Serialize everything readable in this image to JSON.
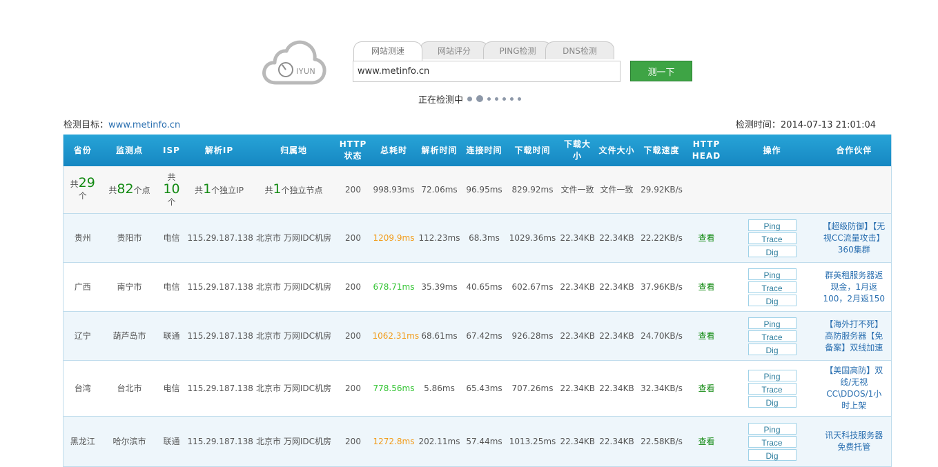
{
  "logo": {
    "text": "IYUN",
    "icon": "cloud-clock-logo"
  },
  "tabs": [
    {
      "label": "网站测速",
      "active": true
    },
    {
      "label": "网站评分",
      "active": false
    },
    {
      "label": "PING检测",
      "active": false
    },
    {
      "label": "DNS检测",
      "active": false
    }
  ],
  "search": {
    "value": "www.metinfo.cn"
  },
  "test_button": "测一下",
  "progress": {
    "label": "正在检测中"
  },
  "meta": {
    "target_label": "检测目标：",
    "target_value": "www.metinfo.cn",
    "time_label": "检测时间：",
    "time_value": "2014-07-13 21:01:04"
  },
  "table": {
    "headers": [
      "省份",
      "监测点",
      "ISP",
      "解析IP",
      "归属地",
      "HTTP状态",
      "总耗时",
      "解析时间",
      "连接时间",
      "下载时间",
      "下载大小",
      "文件大小",
      "下载速度",
      "HTTP HEAD",
      "操作",
      "合作伙伴"
    ],
    "summary": {
      "province_pre": "共",
      "province_num": "29",
      "province_post": "个",
      "points_pre": "共",
      "points_num": "82",
      "points_post": "个点",
      "isp_pre": "共",
      "isp_num": "10",
      "isp_post": "个",
      "ip_pre": "共",
      "ip_num": "1",
      "ip_post": "个独立IP",
      "loc_pre": "共",
      "loc_num": "1",
      "loc_post": "个独立节点",
      "status": "200",
      "total": "998.93ms",
      "resolve": "72.06ms",
      "connect": "96.95ms",
      "download": "829.92ms",
      "dl_size": "文件一致",
      "file_size": "文件一致",
      "speed": "29.92KB/s"
    },
    "ops": {
      "ping": "Ping",
      "trace": "Trace",
      "dig": "Dig"
    },
    "view_label": "查看",
    "rows": [
      {
        "province": "贵州",
        "city": "贵阳市",
        "isp": "电信",
        "ip": "115.29.187.138",
        "location": "北京市 万网IDC机房",
        "status": "200",
        "total": "1209.9ms",
        "total_color": "#f29b18",
        "resolve": "112.23ms",
        "connect": "68.3ms",
        "download": "1029.36ms",
        "dl_size": "22.34KB",
        "file_size": "22.34KB",
        "speed": "22.22KB/s",
        "partner": "【超级防御】【无视CC流量攻击】360集群"
      },
      {
        "province": "广西",
        "city": "南宁市",
        "isp": "电信",
        "ip": "115.29.187.138",
        "location": "北京市 万网IDC机房",
        "status": "200",
        "total": "678.71ms",
        "total_color": "#33c433",
        "resolve": "35.39ms",
        "connect": "40.65ms",
        "download": "602.67ms",
        "dl_size": "22.34KB",
        "file_size": "22.34KB",
        "speed": "37.96KB/s",
        "partner": "群英租服务器返现金，1月返100，2月返150"
      },
      {
        "province": "辽宁",
        "city": "葫芦岛市",
        "isp": "联通",
        "ip": "115.29.187.138",
        "location": "北京市 万网IDC机房",
        "status": "200",
        "total": "1062.31ms",
        "total_color": "#f29b18",
        "resolve": "68.61ms",
        "connect": "67.42ms",
        "download": "926.28ms",
        "dl_size": "22.34KB",
        "file_size": "22.34KB",
        "speed": "24.70KB/s",
        "partner": "【海外打不死】高防服务器【免备案】双线加速"
      },
      {
        "province": "台湾",
        "city": "台北市",
        "isp": "电信",
        "ip": "115.29.187.138",
        "location": "北京市 万网IDC机房",
        "status": "200",
        "total": "778.56ms",
        "total_color": "#33c433",
        "resolve": "5.86ms",
        "connect": "65.43ms",
        "download": "707.26ms",
        "dl_size": "22.34KB",
        "file_size": "22.34KB",
        "speed": "32.34KB/s",
        "partner": "【美国高防】双线/无视CC\\DDOS/1小时上架"
      },
      {
        "province": "黑龙江",
        "city": "哈尔滨市",
        "isp": "联通",
        "ip": "115.29.187.138",
        "location": "北京市 万网IDC机房",
        "status": "200",
        "total": "1272.8ms",
        "total_color": "#f29b18",
        "resolve": "202.11ms",
        "connect": "57.44ms",
        "download": "1013.25ms",
        "dl_size": "22.34KB",
        "file_size": "22.34KB",
        "speed": "22.58KB/s",
        "partner": "讯天科技服务器免费托管"
      }
    ]
  }
}
